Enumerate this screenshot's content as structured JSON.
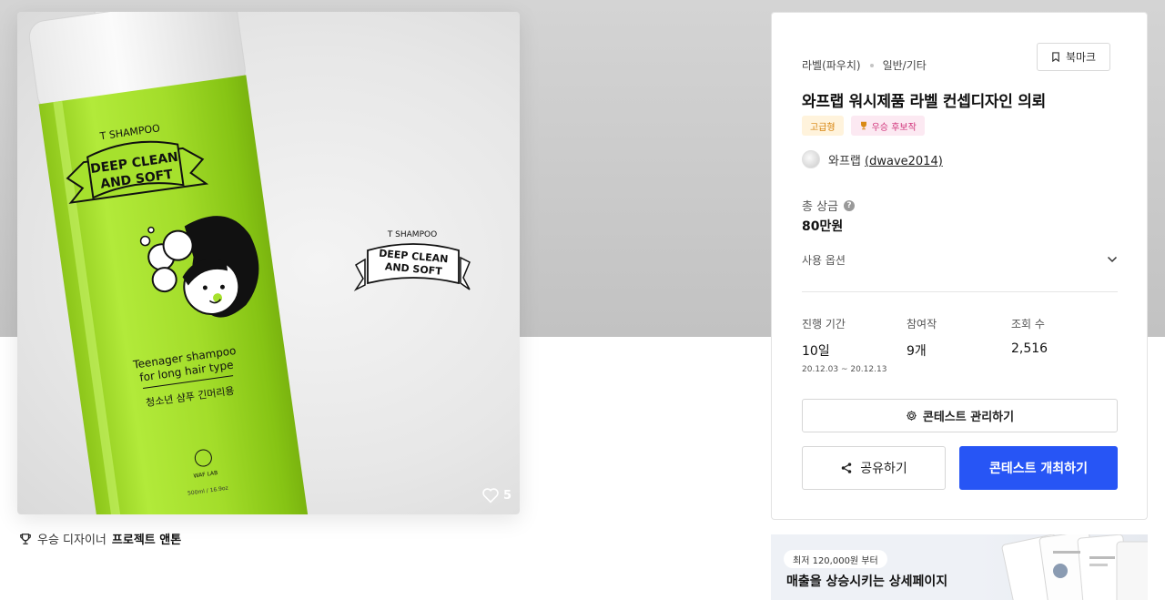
{
  "hero": {
    "bottle": {
      "brand": "T SHAMPOO",
      "headline_line1": "DEEP CLEAN",
      "headline_line2": "AND SOFT",
      "desc_line1": "Teenager shampoo",
      "desc_line2": "for long hair type",
      "korean_desc": "청소년 샴푸 긴머리용",
      "maker": "WAF LAB",
      "volume": "500ml / 16.9oz"
    },
    "label": {
      "brand": "T SHAMPOO",
      "headline_line1": "DEEP CLEAN",
      "headline_line2": "AND SOFT"
    },
    "like_count": "5",
    "icon": "heart-icon"
  },
  "winner": {
    "prefix": "우승 디자이너",
    "name": "프로젝트 앤톤",
    "icon": "trophy-icon"
  },
  "panel": {
    "category1": "라벨(파우치)",
    "category2": "일반/기타",
    "bookmark_label": "북마크",
    "title": "와프랩 워시제품 라벨 컨셉디자인 의뢰",
    "badge_grade": "고급형",
    "badge_award": "우승 후보작",
    "owner_name": "와프랩",
    "owner_handle": "(dwave2014)",
    "prize_label": "총 상금",
    "prize_help": "?",
    "prize_value": "80만원",
    "options_label": "사용 옵션",
    "stats": [
      {
        "label": "진행 기간",
        "value": "10일",
        "sub": "20.12.03 ~ 20.12.13"
      },
      {
        "label": "참여작",
        "value": "9개",
        "sub": ""
      },
      {
        "label": "조회 수",
        "value": "2,516",
        "sub": ""
      }
    ],
    "manage_label": "콘테스트 관리하기",
    "share_label": "공유하기",
    "host_label": "콘테스트 개최하기"
  },
  "ad": {
    "pill": "최저 120,000원 부터",
    "headline": "매출을 상승시키는 상세페이지"
  },
  "colors": {
    "bottle_green": "#a6e12d",
    "primary_button": "#2755f5",
    "grade_badge": "#d6820a",
    "award_badge": "#d0337a"
  }
}
